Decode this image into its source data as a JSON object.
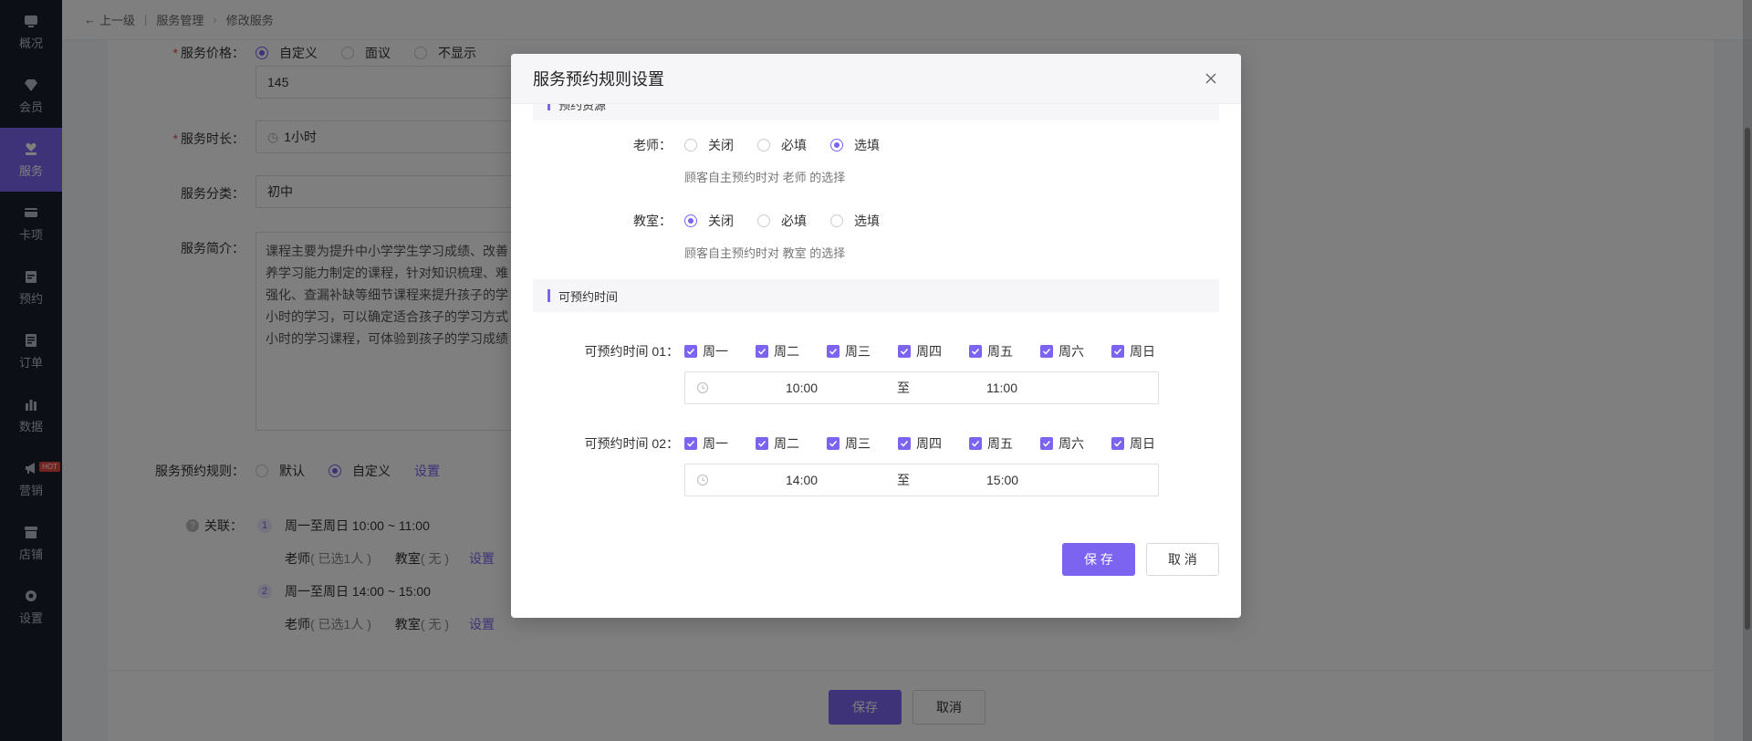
{
  "sidebar": {
    "items": [
      {
        "label": "概况",
        "icon": "monitor-icon"
      },
      {
        "label": "会员",
        "icon": "diamond-icon"
      },
      {
        "label": "服务",
        "icon": "heart-hand-icon"
      },
      {
        "label": "卡项",
        "icon": "card-icon"
      },
      {
        "label": "预约",
        "icon": "calendar-icon"
      },
      {
        "label": "订单",
        "icon": "order-icon"
      },
      {
        "label": "数据",
        "icon": "bar-chart-icon"
      },
      {
        "label": "营销",
        "icon": "megaphone-icon"
      },
      {
        "label": "店铺",
        "icon": "store-icon"
      },
      {
        "label": "设置",
        "icon": "gear-icon"
      }
    ],
    "hot_badge": "HOT",
    "active_color": "#7c64f0"
  },
  "breadcrumb": {
    "back": "上一级",
    "level1": "服务管理",
    "level2": "修改服务"
  },
  "form": {
    "price_label": "服务价格：",
    "price_options": [
      "自定义",
      "面议",
      "不显示"
    ],
    "price_value": "145",
    "duration_label": "服务时长：",
    "duration_value": "1小时",
    "category_label": "服务分类：",
    "category_value": "初中",
    "intro_label": "服务简介：",
    "intro_lines": [
      "课程主要为提升中小学学生学习成绩、改善",
      "养学习能力制定的课程，针对知识梳理、难",
      "强化、查漏补缺等细节课程来提升孩子的学",
      "小时的学习，可以确定适合孩子的学习方式",
      "小时的学习课程，可体验到孩子的学习成绩"
    ],
    "rule_label": "服务预约规则：",
    "rule_options": [
      "默认",
      "自定义"
    ],
    "rule_setting": "设置",
    "related_label": "关联：",
    "related": [
      {
        "num": "1",
        "time": "周一至周日 10:00 ~ 11:00",
        "teacher": "老师",
        "teacher_status": "( 已选1人 )",
        "room": "教室",
        "room_status": "( 无 )",
        "setting": "设置"
      },
      {
        "num": "2",
        "time": "周一至周日 14:00 ~ 15:00",
        "teacher": "老师",
        "teacher_status": "( 已选1人 )",
        "room": "教室",
        "room_status": "( 无 )",
        "setting": "设置"
      }
    ],
    "save": "保存",
    "cancel": "取消"
  },
  "modal": {
    "title": "服务预约规则设置",
    "section1": "预约资源",
    "teacher_label": "老师：",
    "teacher_options": [
      "关闭",
      "必填",
      "选填"
    ],
    "teacher_hint": "顾客自主预约时对 老师 的选择",
    "room_label": "教室：",
    "room_options": [
      "关闭",
      "必填",
      "选填"
    ],
    "room_hint": "顾客自主预约时对 教室 的选择",
    "section2": "可预约时间",
    "days": [
      "周一",
      "周二",
      "周三",
      "周四",
      "周五",
      "周六",
      "周日"
    ],
    "slots": [
      {
        "label": "可预约时间 01：",
        "start": "10:00",
        "to": "至",
        "end": "11:00"
      },
      {
        "label": "可预约时间 02：",
        "start": "14:00",
        "to": "至",
        "end": "15:00"
      }
    ],
    "save": "保 存",
    "cancel": "取 消"
  }
}
